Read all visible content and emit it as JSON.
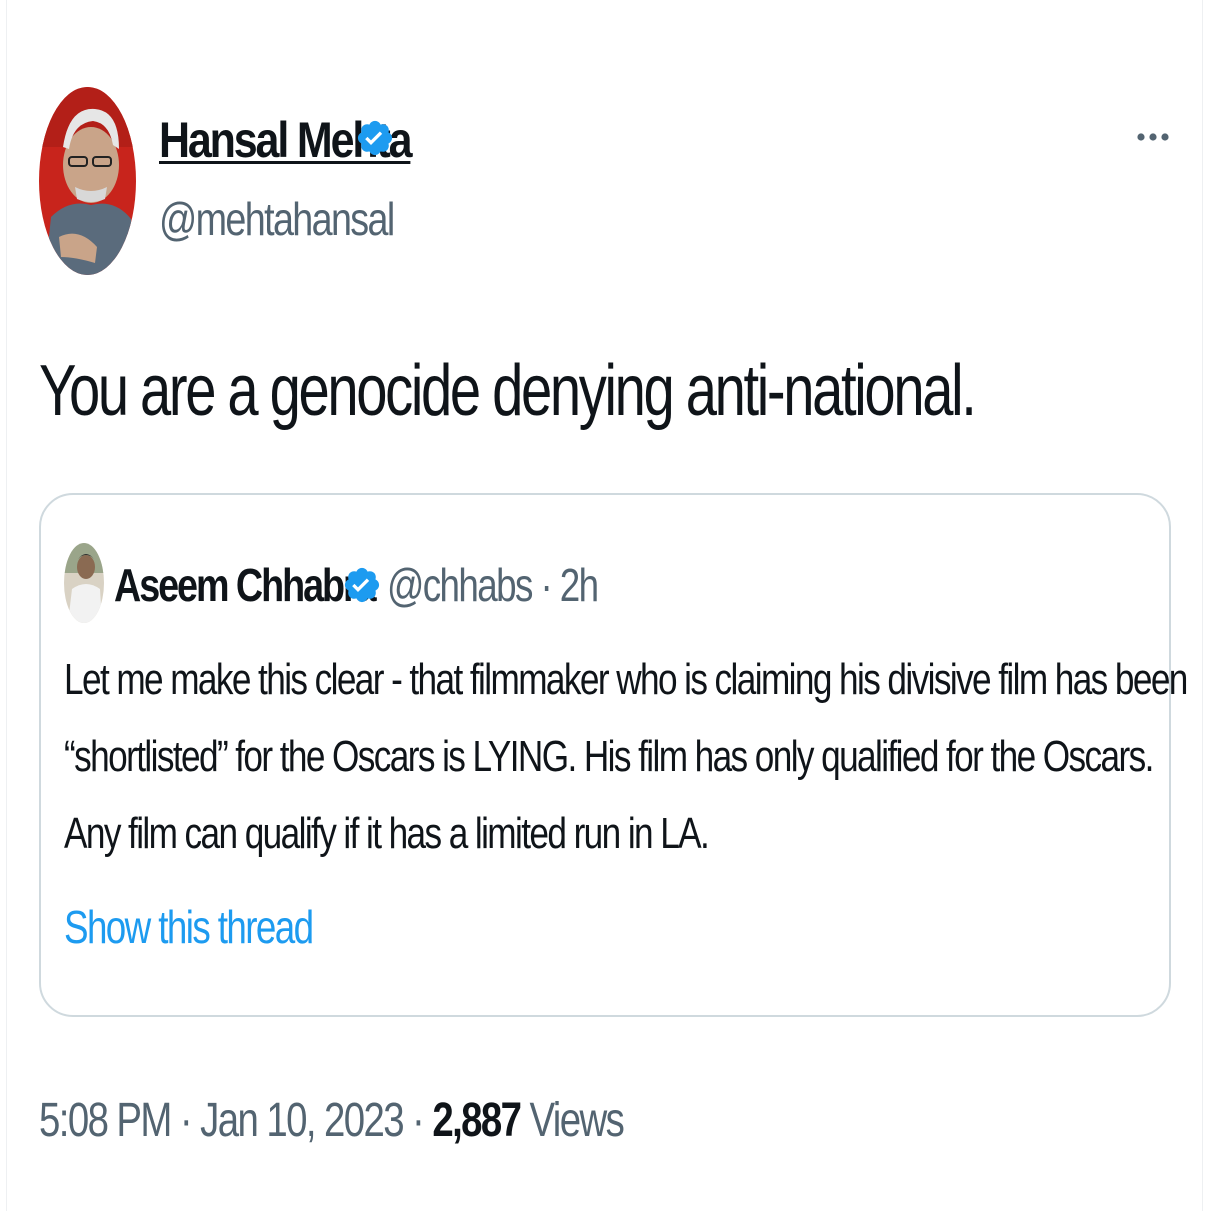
{
  "author": {
    "display_name": "Hansal Mehta",
    "handle": "@mehtahansal",
    "verified": true,
    "avatar_icon": "avatar-photo"
  },
  "more_icon": "more-horizontal-icon",
  "tweet": {
    "text": "You are a genocide denying anti-national."
  },
  "quoted_tweet": {
    "author": {
      "display_name": "Aseem Chhabra",
      "handle_time": "@chhabs · 2h",
      "verified": true
    },
    "lines": [
      "Let me make this clear - that filmmaker who is claiming his divisive film has been",
      "“shortlisted” for the Oscars is LYING. His film has only qualified for the Oscars.",
      "Any film can qualify if it has a limited run in LA."
    ],
    "show_thread": "Show this thread"
  },
  "meta": {
    "time_date": "5:08 PM · Jan 10, 2023 · ",
    "views_count": "2,887",
    "views_label": " Views"
  },
  "colors": {
    "accent": "#1d9bf0",
    "secondary_text": "#536471",
    "border": "#cfd9de",
    "verified_badge": "#1d9bf0"
  }
}
